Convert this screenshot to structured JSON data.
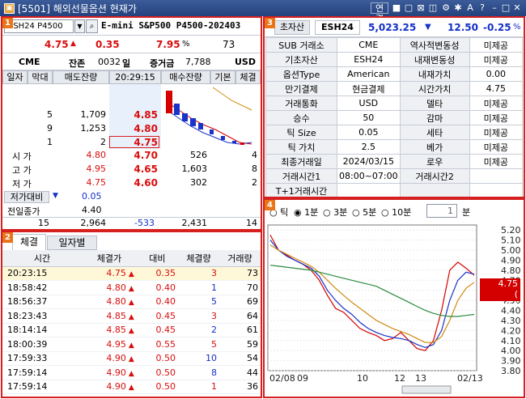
{
  "window": {
    "title": "[5501] 해외선물옵션 현재가",
    "link_button": "연결"
  },
  "p1": {
    "num": "1",
    "code": "ESH24 P4500",
    "name": "E-mini S&P500 P4500-202403",
    "price": "4.75",
    "change": "0.35",
    "rate": "7.95",
    "pct": "%",
    "extra": "73",
    "exchange": "CME",
    "remain_label": "잔존",
    "remain_days": "0032",
    "day_unit": "일",
    "margin_label": "증거금",
    "margin": "7,788",
    "currency": "USD",
    "tabs": [
      "일자",
      "막대",
      "매도잔량",
      "20:29:15",
      "매수잔량",
      "기본",
      "체결"
    ],
    "asks": [
      {
        "qty": "5",
        "vol": "1,709",
        "price": "4.85"
      },
      {
        "qty": "9",
        "vol": "1,253",
        "price": "4.80"
      },
      {
        "qty": "1",
        "vol": "2",
        "price": "4.75"
      }
    ],
    "bids": [
      {
        "label": "시   가",
        "ref": "4.80",
        "price": "4.70",
        "vol": "526",
        "qty": "4"
      },
      {
        "label": "고   가",
        "ref": "4.95",
        "price": "4.65",
        "vol": "1,603",
        "qty": "8"
      },
      {
        "label": "저   가",
        "ref": "4.75",
        "price": "4.60",
        "vol": "302",
        "qty": "2"
      }
    ],
    "prev_compare_label": "저가대비",
    "prev_compare": "0.05",
    "prev_close_label": "전일종가",
    "prev_close": "4.40",
    "totals": {
      "a": "15",
      "b": "2,964",
      "c": "-533",
      "d": "2,431",
      "e": "14"
    }
  },
  "p2": {
    "num": "2",
    "tab_trades": "체결",
    "tab_daily": "일자별",
    "headers": [
      "시간",
      "체결가",
      "대비",
      "체결량",
      "거래량"
    ],
    "rows": [
      {
        "time": "20:23:15",
        "price": "4.75",
        "change": "0.35",
        "qty": "3",
        "vol": "73",
        "qc": "red"
      },
      {
        "time": "18:58:42",
        "price": "4.80",
        "change": "0.40",
        "qty": "1",
        "vol": "70",
        "qc": "blue"
      },
      {
        "time": "18:56:37",
        "price": "4.80",
        "change": "0.40",
        "qty": "5",
        "vol": "69",
        "qc": "blue"
      },
      {
        "time": "18:23:43",
        "price": "4.85",
        "change": "0.45",
        "qty": "3",
        "vol": "64",
        "qc": "red"
      },
      {
        "time": "18:14:14",
        "price": "4.85",
        "change": "0.45",
        "qty": "2",
        "vol": "61",
        "qc": "blue"
      },
      {
        "time": "18:00:39",
        "price": "4.95",
        "change": "0.55",
        "qty": "5",
        "vol": "59",
        "qc": "red"
      },
      {
        "time": "17:59:33",
        "price": "4.90",
        "change": "0.50",
        "qty": "10",
        "vol": "54",
        "qc": "blue"
      },
      {
        "time": "17:59:14",
        "price": "4.90",
        "change": "0.50",
        "qty": "8",
        "vol": "44",
        "qc": "blue"
      },
      {
        "time": "17:59:14",
        "price": "4.90",
        "change": "0.50",
        "qty": "1",
        "vol": "36",
        "qc": "red"
      }
    ]
  },
  "p3": {
    "num": "3",
    "underlying_tab": "초자산",
    "underlying_code": "ESH24",
    "underlying_price": "5,023.25",
    "underlying_change": "12.50",
    "underlying_rate": "-0.25",
    "pct": "%",
    "rows": [
      [
        "SUB 거래소",
        "CME",
        "역사적변동성",
        "미제공"
      ],
      [
        "기초자산",
        "ESH24",
        "내재변동성",
        "미제공"
      ],
      [
        "옵션Type",
        "American",
        "내재가치",
        "0.00"
      ],
      [
        "만기결제",
        "현금결제",
        "시간가치",
        "4.75"
      ],
      [
        "거래통화",
        "USD",
        "델타",
        "미제공"
      ],
      [
        "승수",
        "50",
        "감마",
        "미제공"
      ],
      [
        "틱 Size",
        "0.05",
        "세타",
        "미제공"
      ],
      [
        "틱 가치",
        "2.5",
        "베가",
        "미제공"
      ],
      [
        "최종거래일",
        "2024/03/15",
        "로우",
        "미제공"
      ],
      [
        "거래시간1",
        "08:00~07:00",
        "거래시간2",
        ""
      ],
      [
        "T+1거래시간",
        "",
        "",
        ""
      ]
    ]
  },
  "p4": {
    "num": "4",
    "opts": [
      "틱",
      "1분",
      "3분",
      "5분",
      "10분"
    ],
    "interval_value": "1",
    "interval_unit": "분",
    "price_tag": "4.75",
    "rate_tag": "( 7.95%)"
  },
  "chart_data": {
    "type": "line",
    "x_labels": [
      "02/08",
      "09",
      "10",
      "12",
      "13",
      "02/13"
    ],
    "y_ticks": [
      "5.20",
      "5.10",
      "5.00",
      "4.90",
      "4.80",
      "4.70",
      "4.60",
      "4.50",
      "4.40",
      "4.30",
      "4.20",
      "4.10",
      "4.00",
      "3.90",
      "3.80"
    ],
    "ylim": [
      3.8,
      5.25
    ],
    "series": [
      {
        "color": "#d60000",
        "values": [
          5.15,
          5.0,
          4.95,
          4.9,
          4.86,
          4.8,
          4.7,
          4.55,
          4.42,
          4.38,
          4.3,
          4.22,
          4.18,
          4.15,
          4.1,
          4.12,
          4.18,
          4.1,
          4.02,
          4.0,
          4.1,
          4.4,
          4.8,
          4.88,
          4.82,
          4.75
        ]
      },
      {
        "color": "#1a33c8",
        "values": [
          5.1,
          5.0,
          4.94,
          4.9,
          4.86,
          4.82,
          4.74,
          4.6,
          4.5,
          4.42,
          4.36,
          4.28,
          4.22,
          4.18,
          4.15,
          4.13,
          4.12,
          4.1,
          4.06,
          4.03,
          4.06,
          4.2,
          4.5,
          4.7,
          4.78,
          4.76
        ]
      },
      {
        "color": "#d08a10",
        "values": [
          5.05,
          5.0,
          4.96,
          4.92,
          4.88,
          4.84,
          4.78,
          4.7,
          4.62,
          4.55,
          4.48,
          4.42,
          4.36,
          4.3,
          4.26,
          4.22,
          4.19,
          4.16,
          4.12,
          4.08,
          4.08,
          4.14,
          4.3,
          4.5,
          4.62,
          4.68
        ]
      },
      {
        "color": "#2a8a3a",
        "values": [
          4.85,
          4.84,
          4.83,
          4.82,
          4.81,
          4.8,
          4.78,
          4.76,
          4.74,
          4.72,
          4.7,
          4.68,
          4.66,
          4.64,
          4.6,
          4.56,
          4.52,
          4.48,
          4.44,
          4.4,
          4.37,
          4.35,
          4.34,
          4.34,
          4.35,
          4.36
        ]
      }
    ]
  }
}
